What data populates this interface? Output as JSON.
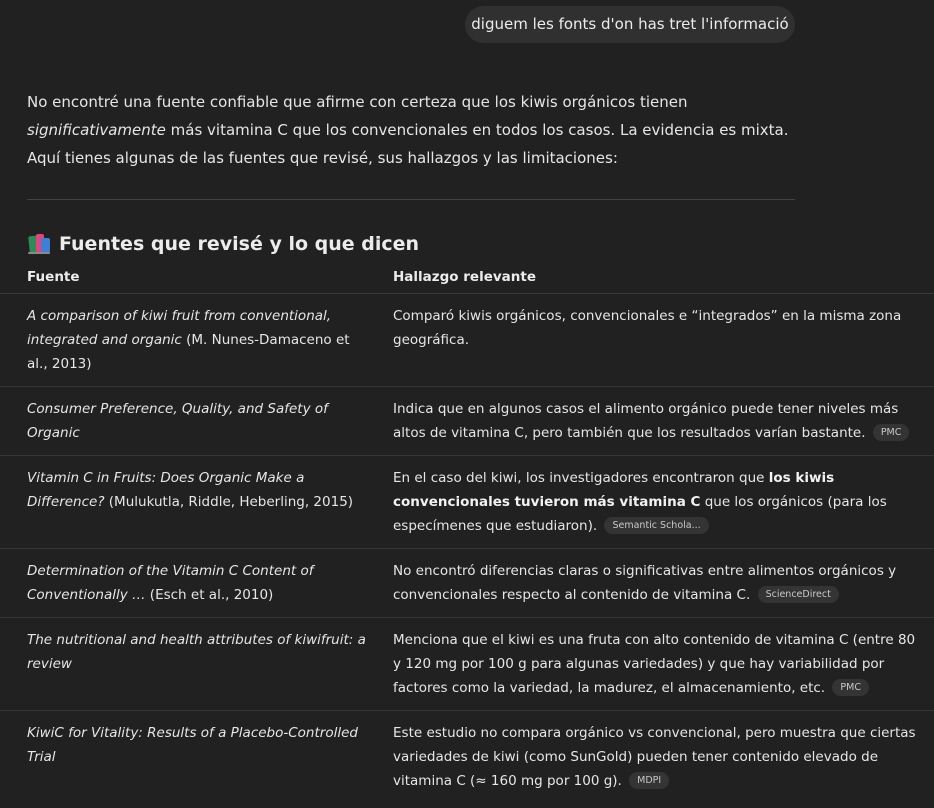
{
  "user_message": "diguem les fonts d'on has tret l'informació",
  "intro": {
    "part1": "No encontré una fuente confiable que afirme con certeza que los kiwis orgánicos tienen ",
    "emphasis": "significativamente",
    "part2": " más vitamina C que los convencionales en todos los casos. La evidencia es mixta. Aquí tienes algunas de las fuentes que revisé, sus hallazgos y las limitaciones:"
  },
  "section": {
    "heading": "Fuentes que revisé y lo que dicen",
    "icon": "books-icon"
  },
  "table": {
    "headers": [
      "Fuente",
      "Hallazgo relevante"
    ],
    "rows": [
      {
        "source_title": "A comparison of kiwi fruit from conventional, integrated and organic",
        "source_rest": " (M. Nunes-Damaceno et al., 2013)",
        "finding_a": "Comparó kiwis orgánicos, convencionales e “integrados” en la misma zona geográfica.",
        "finding_bold": "",
        "finding_b": "",
        "badge": ""
      },
      {
        "source_title": "Consumer Preference, Quality, and Safety of Organic",
        "source_rest": "",
        "finding_a": "Indica que en algunos casos el alimento orgánico puede tener niveles más altos de vitamina C, pero también que los resultados varían bastante.",
        "finding_bold": "",
        "finding_b": "",
        "badge": "PMC"
      },
      {
        "source_title": "Vitamin C in Fruits: Does Organic Make a Difference?",
        "source_rest": " (Mulukutla, Riddle, Heberling, 2015)",
        "finding_a": "En el caso del kiwi, los investigadores encontraron que ",
        "finding_bold": "los kiwis convencionales tuvieron más vitamina C",
        "finding_b": " que los orgánicos (para los especímenes que estudiaron).",
        "badge": "Semantic Schola..."
      },
      {
        "source_title": "Determination of the Vitamin C Content of Conventionally …",
        "source_rest": " (Esch et al., 2010)",
        "finding_a": "No encontró diferencias claras o significativas entre alimentos orgánicos y convencionales respecto al contenido de vitamina C.",
        "finding_bold": "",
        "finding_b": "",
        "badge": "ScienceDirect"
      },
      {
        "source_title": "The nutritional and health attributes of kiwifruit: a review",
        "source_rest": "",
        "finding_a": "Menciona que el kiwi es una fruta con alto contenido de vitamina C (entre 80 y 120 mg por 100 g para algunas variedades) y que hay variabilidad por factores como la variedad, la madurez, el almacenamiento, etc.",
        "finding_bold": "",
        "finding_b": "",
        "badge": "PMC"
      },
      {
        "source_title": "KiwiC for Vitality: Results of a Placebo-Controlled Trial",
        "source_rest": "",
        "finding_a": "Este estudio no compara orgánico vs convencional, pero muestra que ciertas variedades de kiwi (como SunGold) pueden tener contenido elevado de vitamina C (≈ 160 mg por 100 g).",
        "finding_bold": "",
        "finding_b": "",
        "badge": "MDPI"
      }
    ]
  }
}
